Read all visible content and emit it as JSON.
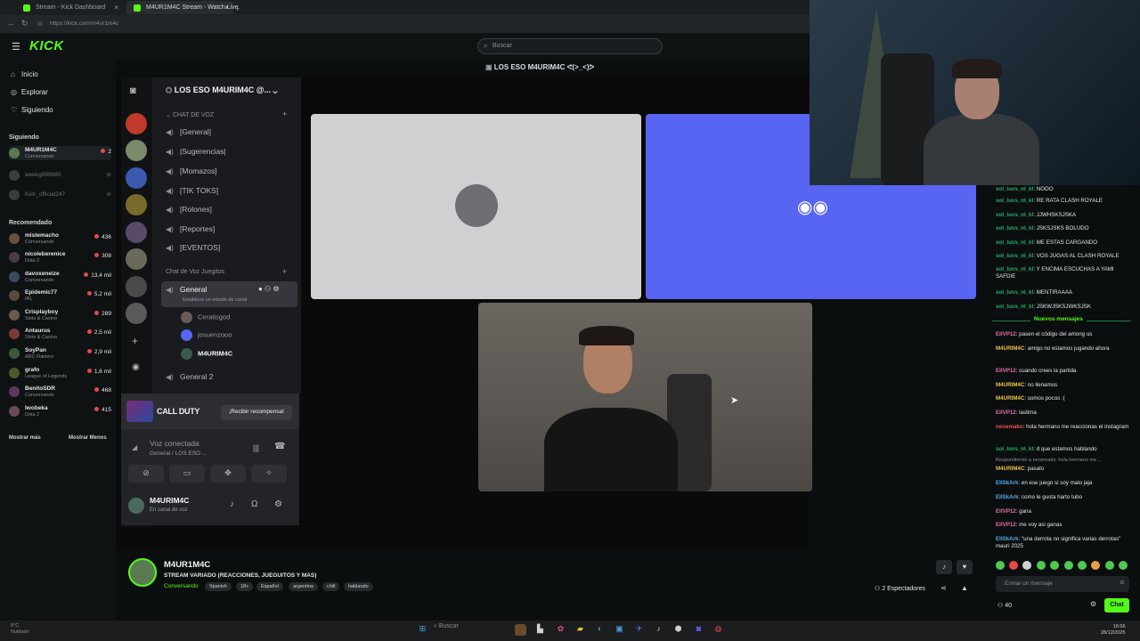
{
  "browser": {
    "tabs": [
      "Stream - Kick Dashboard",
      "M4UR1M4C Stream - Watch Live"
    ],
    "url": "https://kick.com/m4ur1m4c"
  },
  "kick": {
    "search_placeholder": "Buscar",
    "nav": [
      {
        "icon": "home-icon",
        "label": "Inicio"
      },
      {
        "icon": "compass-icon",
        "label": "Explorar"
      },
      {
        "icon": "heart-icon",
        "label": "Siguiendo"
      }
    ],
    "following_header": "Siguiendo",
    "following": [
      {
        "name": "M4UR1M4C",
        "category": "Conversando",
        "count": "2",
        "online": true
      },
      {
        "name": "axelcg999980",
        "category": "",
        "count": "",
        "online": false
      },
      {
        "name": "Kick_official247",
        "category": "",
        "count": "",
        "online": false
      }
    ],
    "recommended_header": "Recomendado",
    "recommended": [
      {
        "name": "mistemacho",
        "category": "Conversando",
        "count": "436"
      },
      {
        "name": "nicoleberenice",
        "category": "Dota 2",
        "count": "308"
      },
      {
        "name": "davoxeneize",
        "category": "Conversando",
        "count": "13,4 mil"
      },
      {
        "name": "Epidemic77",
        "category": "IRL",
        "count": "5,2 mil"
      },
      {
        "name": "Crisplayboy",
        "category": "Slots & Casino",
        "count": "289"
      },
      {
        "name": "Antaurus",
        "category": "Slots & Casino",
        "count": "2,5 mil"
      },
      {
        "name": "SoyPan",
        "category": "ARC Raiders",
        "count": "2,9 mil"
      },
      {
        "name": "grafo",
        "category": "League of Legends",
        "count": "1,6 mil"
      },
      {
        "name": "BenitoSDR",
        "category": "Conversando",
        "count": "468"
      },
      {
        "name": "lwobeka",
        "category": "Dota 2",
        "count": "415"
      }
    ],
    "show_more": "Mostrar más",
    "show_less": "Mostrar Menos"
  },
  "discord": {
    "server_name": "LOS ESO M4URIM4C @...",
    "voice_header": "CHAT DE VOZ",
    "channels": [
      "[General]",
      "|Sugerencias|",
      "[Momazos]",
      "[TIK TOKS]",
      "[Rolones]",
      "[Reportes]",
      "[EVENTOS]"
    ],
    "games_header": "Chat de Voz Juegitos",
    "active_channel": "General",
    "active_status": "Establece un estado de canal",
    "members": [
      "Ceratisgod",
      "josuenzooo",
      "M4URIM4C"
    ],
    "next_channel": "General 2",
    "promo_brand": "CALL DUTY",
    "promo_button": "¡Recibir recompensa!",
    "voice_connected": "Voz conectada",
    "voice_sub": "General / LOS ESO ...",
    "user_name": "M4URIM4C",
    "user_status": "En canal de voz",
    "call_title": "LOS ESO M4URIM4C ᕙ(>_<)ᕗ"
  },
  "chat": {
    "messages": [
      {
        "user": "sol_luvs_nl_kl",
        "text": "NOOO",
        "color": "u-g"
      },
      {
        "user": "sol_luvs_nl_kl",
        "text": "RE RATA CLASH ROYALE",
        "color": "u-g"
      },
      {
        "user": "sol_luvs_nl_kl",
        "text": "JJWHSKSJSKA",
        "color": "u-g"
      },
      {
        "user": "sol_luvs_nl_kl",
        "text": "JSKSJSKS BOLUDO",
        "color": "u-g"
      },
      {
        "user": "sol_luvs_nl_kl",
        "text": "ME ESTAS CARGANDO",
        "color": "u-g"
      },
      {
        "user": "sol_luvs_nl_kl",
        "text": "VOS JUGAS AL CLASH ROYALE",
        "color": "u-g"
      },
      {
        "user": "sol_luvs_nl_kl",
        "text": "Y ENCIMA ESCUCHAS A YAMI SAFDIE",
        "color": "u-g"
      },
      {
        "user": "sol_luvs_nl_kl",
        "text": "MENTIRAAAA",
        "color": "u-g"
      },
      {
        "user": "sol_luvs_nl_kl",
        "text": "JSKWJSKSJWKSJSK",
        "color": "u-g"
      }
    ],
    "new_messages_label": "Nuevos mensajes",
    "new_messages": [
      {
        "user": "ElIVP12",
        "text": "pasen el código del among us",
        "color": "u-p"
      },
      {
        "user": "M4URIM4C",
        "text": "amigo no estamos jugando ahora",
        "color": "u-y"
      },
      {
        "user": "ElIVP12",
        "text": "cuando crees la partida",
        "color": "u-p"
      },
      {
        "user": "M4URIM4C",
        "text": "no llenamos",
        "color": "u-y"
      },
      {
        "user": "M4URIM4C",
        "text": "somos pocos :(",
        "color": "u-y"
      },
      {
        "user": "ElIVP12",
        "text": "lastima",
        "color": "u-p"
      },
      {
        "user": "nenemako",
        "text": "hola hermano me reaccionas el instagram",
        "color": "u-r"
      },
      {
        "user": "sol_luvs_nl_kl",
        "text": "d que estamos hablando",
        "color": "u-g"
      },
      {
        "user": "M4URIM4C",
        "text": "pasalo",
        "color": "u-y",
        "reply": "Respondiendo a nenemako: hola hermano me ..."
      },
      {
        "user": "ElISkArk",
        "text": "en ese juego si soy malo jaja",
        "color": "u-b"
      },
      {
        "user": "ElISkArk",
        "text": "como le gusta harto tubo",
        "color": "u-b"
      },
      {
        "user": "ElIVP12",
        "text": "gana",
        "color": "u-p"
      },
      {
        "user": "ElIVP12",
        "text": "me voy asi ganas",
        "color": "u-p"
      },
      {
        "user": "ElISkArk",
        "text": "\"una derrota no significa varias derrotas\" mauri 2025",
        "color": "u-b"
      }
    ],
    "input_placeholder": "Enviar un mensaje",
    "points": "40",
    "send_label": "Chat"
  },
  "stream": {
    "name": "M4UR1M4C",
    "title": "STREAM VARIADO (REACCIONES, JUEGUITOS Y MAS)",
    "category": "Conversando",
    "tags": [
      "Spanish",
      "18+",
      "Español",
      "argentina",
      "chill",
      "hablando"
    ],
    "viewers": "2 Espectadores"
  },
  "taskbar": {
    "search": "Buscar",
    "weather": [
      "8°C",
      "Nublado"
    ],
    "time": "16:56",
    "date": "28/12/2025"
  }
}
